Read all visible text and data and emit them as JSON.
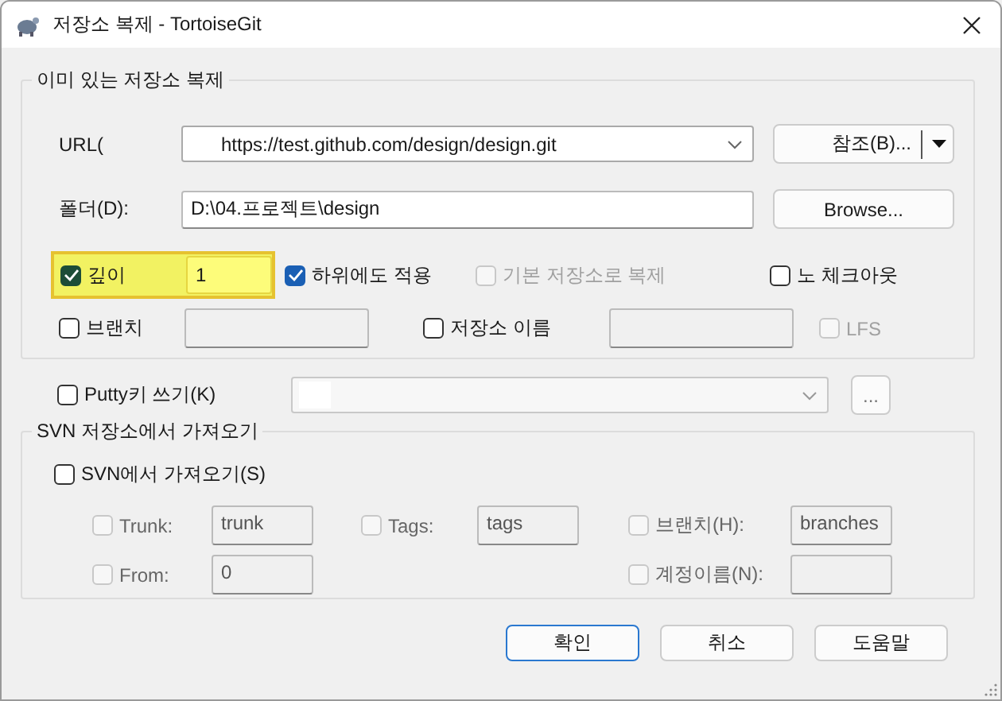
{
  "window": {
    "title": "저장소 복제 - TortoiseGit"
  },
  "clone_group": {
    "title": "이미 있는 저장소 복제",
    "url": {
      "label": "URL(",
      "value": "https://test.github.com/design/design.git",
      "button": "참조(B)..."
    },
    "directory": {
      "label": "폴더(D):",
      "value": "D:\\04.프로젝트\\design",
      "button": "Browse..."
    },
    "depth": {
      "label": "깊이",
      "checked": true,
      "value": "1",
      "highlighted": true
    },
    "options": [
      {
        "label": "하위에도 적용",
        "checked": true,
        "disabled": false
      },
      {
        "label": "기본 저장소로 복제",
        "checked": false,
        "disabled": true
      },
      {
        "label": "노 체크아웃",
        "checked": false,
        "disabled": false
      }
    ],
    "branch": {
      "label": "브랜치",
      "checked": false
    },
    "origin_name": {
      "label": "저장소 이름",
      "checked": false
    },
    "lfs": {
      "label": "LFS",
      "checked": false,
      "disabled": true
    }
  },
  "putty": {
    "label": "Putty키 쓰기(K)",
    "checked": false,
    "more_button": "..."
  },
  "svn_group": {
    "title": "SVN 저장소에서 가져오기",
    "from_svn": {
      "label": "SVN에서 가져오기(S)",
      "checked": false
    },
    "rows": [
      [
        {
          "label": "Trunk:",
          "value": "trunk",
          "checked": false,
          "disabled": true
        },
        {
          "label": "Tags:",
          "value": "tags",
          "checked": false,
          "disabled": true
        },
        {
          "label": "브랜치(H):",
          "value": "branches",
          "checked": false,
          "disabled": true
        }
      ],
      [
        {
          "label": "From:",
          "value": "0",
          "checked": false,
          "disabled": true
        },
        "",
        {
          "label": "계정이름(N):",
          "checked": false,
          "disabled": true
        }
      ]
    ]
  },
  "buttons": [
    {
      "label": "확인",
      "default": true
    },
    {
      "label": "취소",
      "default": false
    },
    {
      "label": "도움말",
      "default": false
    }
  ]
}
